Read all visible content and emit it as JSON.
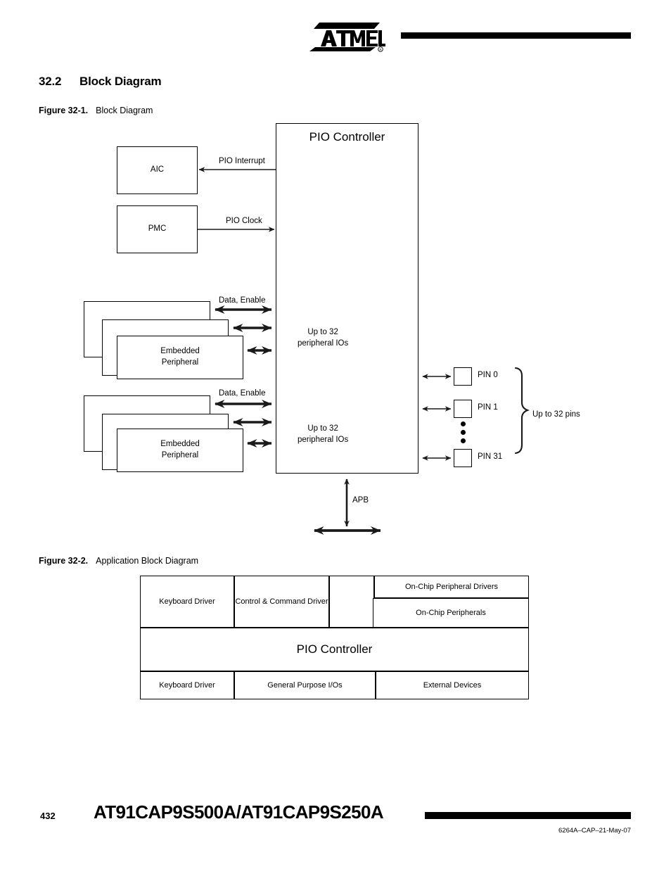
{
  "header": {
    "logo_name": "ATMEL",
    "logo_registered_mark": "®"
  },
  "section": {
    "number": "32.2",
    "title": "Block Diagram"
  },
  "figure1": {
    "caption_label": "Figure 32-1.",
    "caption_text": "Block Diagram",
    "pio_controller_title": "PIO Controller",
    "aic_label": "AIC",
    "pmc_label": "PMC",
    "pio_interrupt_label": "PIO Interrupt",
    "pio_clock_label": "PIO Clock",
    "data_enable_label_top": "Data, Enable",
    "data_enable_label_bottom": "Data, Enable",
    "peripheral_ios_line1": "Up to 32",
    "peripheral_ios_line2": "peripheral IOs",
    "embedded_peripheral_line1": "Embedded",
    "embedded_peripheral_line2": "Peripheral",
    "apb_label": "APB",
    "up_to_32_pins_label": "Up to 32 pins",
    "pins": [
      {
        "label": "PIN 0"
      },
      {
        "label": "PIN 1"
      },
      {
        "label": "PIN 31"
      }
    ]
  },
  "figure2": {
    "caption_label": "Figure 32-2.",
    "caption_text": "Application Block Diagram",
    "cells": {
      "keyboard_driver_top": "Keyboard Driver",
      "control_command_driver": "Control & Command Driver",
      "empty": "",
      "onchip_peripheral_drivers": "On-Chip Peripheral Drivers",
      "onchip_peripherals": "On-Chip Peripherals",
      "pio_controller": "PIO Controller",
      "keyboard_driver_bottom": "Keyboard Driver",
      "general_purpose_ios": "General Purpose I/Os",
      "external_devices": "External Devices"
    }
  },
  "footer": {
    "page_number": "432",
    "title": "AT91CAP9S500A/AT91CAP9S250A",
    "doc_ref": "6264A–CAP–21-May-07"
  }
}
